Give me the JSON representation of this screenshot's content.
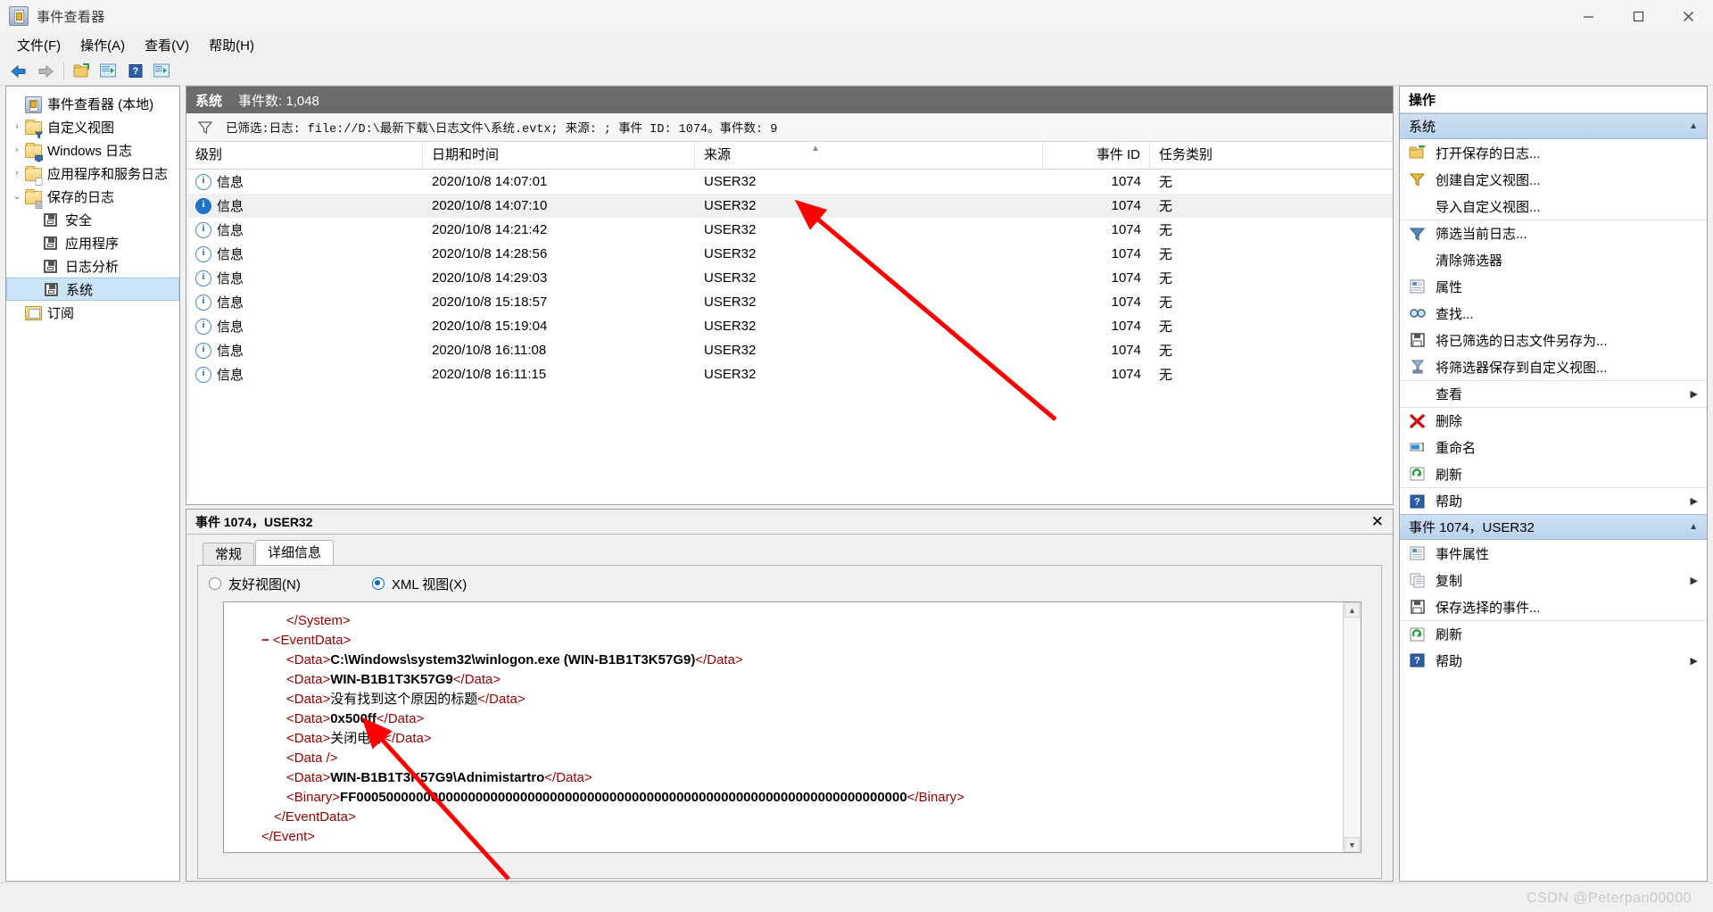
{
  "window": {
    "title": "事件查看器",
    "minimize": "—",
    "maximize": "□",
    "close": "✕"
  },
  "menu": {
    "items": [
      "文件(F)",
      "操作(A)",
      "查看(V)",
      "帮助(H)"
    ]
  },
  "toolbar": {
    "buttons": [
      "back-arrow",
      "forward-arrow",
      "open-saved-log",
      "new-custom-view",
      "help",
      "show-hide-action-pane"
    ]
  },
  "tree": {
    "root": {
      "label": "事件查看器 (本地)"
    },
    "items": [
      {
        "label": "自定义视图",
        "icon": "folder-filter-icon",
        "twist": "›",
        "indent": 1,
        "type": "folder"
      },
      {
        "label": "Windows 日志",
        "icon": "folder-computer-icon",
        "twist": "›",
        "indent": 1,
        "type": "folder"
      },
      {
        "label": "应用程序和服务日志",
        "icon": "folder-apps-icon",
        "twist": "›",
        "indent": 1,
        "type": "folder"
      },
      {
        "label": "保存的日志",
        "icon": "folder-saved-icon",
        "twist": "⌄",
        "indent": 1,
        "type": "folder"
      },
      {
        "label": "安全",
        "icon": "disk-icon",
        "twist": "",
        "indent": 2,
        "type": "log"
      },
      {
        "label": "应用程序",
        "icon": "disk-icon",
        "twist": "",
        "indent": 2,
        "type": "log"
      },
      {
        "label": "日志分析",
        "icon": "disk-icon",
        "twist": "",
        "indent": 2,
        "type": "log"
      },
      {
        "label": "系统",
        "icon": "disk-icon",
        "twist": "",
        "indent": 2,
        "type": "log",
        "selected": true
      },
      {
        "label": "订阅",
        "icon": "subscription-icon",
        "twist": "",
        "indent": 1,
        "type": "subscription"
      }
    ]
  },
  "log": {
    "name": "系统",
    "count_label": "事件数: 1,048",
    "filter_text": "已筛选:日志: file://D:\\最新下载\\日志文件\\系统.evtx; 来源: ; 事件 ID: 1074。事件数: 9"
  },
  "grid": {
    "columns": [
      "级别",
      "日期和时间",
      "来源",
      "事件 ID",
      "任务类别"
    ],
    "sorted_column_index": 1,
    "rows": [
      {
        "level": "信息",
        "datetime": "2020/10/8 14:07:01",
        "source": "USER32",
        "event_id": "1074",
        "task": "无",
        "selected": false
      },
      {
        "level": "信息",
        "datetime": "2020/10/8 14:07:10",
        "source": "USER32",
        "event_id": "1074",
        "task": "无",
        "selected": true
      },
      {
        "level": "信息",
        "datetime": "2020/10/8 14:21:42",
        "source": "USER32",
        "event_id": "1074",
        "task": "无",
        "selected": false
      },
      {
        "level": "信息",
        "datetime": "2020/10/8 14:28:56",
        "source": "USER32",
        "event_id": "1074",
        "task": "无",
        "selected": false
      },
      {
        "level": "信息",
        "datetime": "2020/10/8 14:29:03",
        "source": "USER32",
        "event_id": "1074",
        "task": "无",
        "selected": false
      },
      {
        "level": "信息",
        "datetime": "2020/10/8 15:18:57",
        "source": "USER32",
        "event_id": "1074",
        "task": "无",
        "selected": false
      },
      {
        "level": "信息",
        "datetime": "2020/10/8 15:19:04",
        "source": "USER32",
        "event_id": "1074",
        "task": "无",
        "selected": false
      },
      {
        "level": "信息",
        "datetime": "2020/10/8 16:11:08",
        "source": "USER32",
        "event_id": "1074",
        "task": "无",
        "selected": false
      },
      {
        "level": "信息",
        "datetime": "2020/10/8 16:11:15",
        "source": "USER32",
        "event_id": "1074",
        "task": "无",
        "selected": false
      }
    ]
  },
  "detail": {
    "header": "事件 1074，USER32",
    "close": "✕",
    "tabs": [
      {
        "label": "常规",
        "active": false
      },
      {
        "label": "详细信息",
        "active": true
      }
    ],
    "view_modes": [
      {
        "label": "友好视图(N)",
        "selected": false
      },
      {
        "label": "XML 视图(X)",
        "selected": true
      }
    ],
    "xml_lines": [
      {
        "indent": 3,
        "minus": false,
        "parts": [
          {
            "t": "tag",
            "v": "</System>"
          }
        ]
      },
      {
        "indent": 1,
        "minus": true,
        "parts": [
          {
            "t": "tag",
            "v": "<EventData>"
          }
        ]
      },
      {
        "indent": 3,
        "minus": false,
        "parts": [
          {
            "t": "tag",
            "v": "<Data>"
          },
          {
            "t": "bold",
            "v": "C:\\Windows\\system32\\winlogon.exe (WIN-B1B1T3K57G9)"
          },
          {
            "t": "tag",
            "v": "</Data>"
          }
        ]
      },
      {
        "indent": 3,
        "minus": false,
        "parts": [
          {
            "t": "tag",
            "v": "<Data>"
          },
          {
            "t": "bold",
            "v": "WIN-B1B1T3K57G9"
          },
          {
            "t": "tag",
            "v": "</Data>"
          }
        ]
      },
      {
        "indent": 3,
        "minus": false,
        "parts": [
          {
            "t": "tag",
            "v": "<Data>"
          },
          {
            "t": "plain",
            "v": "没有找到这个原因的标题"
          },
          {
            "t": "tag",
            "v": "</Data>"
          }
        ]
      },
      {
        "indent": 3,
        "minus": false,
        "parts": [
          {
            "t": "tag",
            "v": "<Data>"
          },
          {
            "t": "bold",
            "v": "0x500ff"
          },
          {
            "t": "tag",
            "v": "</Data>"
          }
        ]
      },
      {
        "indent": 3,
        "minus": false,
        "parts": [
          {
            "t": "tag",
            "v": "<Data>"
          },
          {
            "t": "plain",
            "v": "关闭电源"
          },
          {
            "t": "tag",
            "v": "</Data>"
          }
        ]
      },
      {
        "indent": 3,
        "minus": false,
        "parts": [
          {
            "t": "tag",
            "v": "<Data />"
          }
        ]
      },
      {
        "indent": 3,
        "minus": false,
        "parts": [
          {
            "t": "tag",
            "v": "<Data>"
          },
          {
            "t": "bold",
            "v": "WIN-B1B1T3K57G9\\Adnimistartro"
          },
          {
            "t": "tag",
            "v": "</Data>"
          }
        ]
      },
      {
        "indent": 3,
        "minus": false,
        "parts": [
          {
            "t": "tag",
            "v": "<Binary>"
          },
          {
            "t": "bold",
            "v": "FF00050000000000000000000000000000000000000000000000000000000000000000000000"
          },
          {
            "t": "tag",
            "v": "</Binary>"
          }
        ]
      },
      {
        "indent": 2,
        "minus": false,
        "parts": [
          {
            "t": "tag",
            "v": "</EventData>"
          }
        ]
      },
      {
        "indent": 1,
        "minus": false,
        "parts": [
          {
            "t": "tag",
            "v": "</Event>"
          }
        ]
      }
    ]
  },
  "actions": {
    "title": "操作",
    "groups": [
      {
        "name": "系统",
        "collapse": "▲",
        "items": [
          {
            "label": "打开保存的日志...",
            "icon": "open-saved-log-icon",
            "submenu": false,
            "separator_above": false
          },
          {
            "label": "创建自定义视图...",
            "icon": "create-custom-view-icon",
            "submenu": false,
            "separator_above": false
          },
          {
            "label": "导入自定义视图...",
            "icon": "",
            "submenu": false,
            "separator_above": false
          },
          {
            "label": "筛选当前日志...",
            "icon": "filter-current-log-icon",
            "submenu": false,
            "separator_above": true
          },
          {
            "label": "清除筛选器",
            "icon": "",
            "submenu": false,
            "separator_above": false
          },
          {
            "label": "属性",
            "icon": "properties-icon",
            "submenu": false,
            "separator_above": false
          },
          {
            "label": "查找...",
            "icon": "find-icon",
            "submenu": false,
            "separator_above": false
          },
          {
            "label": "将已筛选的日志文件另存为...",
            "icon": "save-filtered-log-icon",
            "submenu": false,
            "separator_above": false
          },
          {
            "label": "将筛选器保存到自定义视图...",
            "icon": "save-filter-to-custom-view-icon",
            "submenu": false,
            "separator_above": false
          },
          {
            "label": "查看",
            "icon": "",
            "submenu": true,
            "separator_above": true
          },
          {
            "label": "删除",
            "icon": "delete-icon",
            "submenu": false,
            "separator_above": true
          },
          {
            "label": "重命名",
            "icon": "rename-icon",
            "submenu": false,
            "separator_above": false
          },
          {
            "label": "刷新",
            "icon": "refresh-icon",
            "submenu": false,
            "separator_above": false
          },
          {
            "label": "帮助",
            "icon": "help-icon",
            "submenu": true,
            "separator_above": true
          }
        ]
      },
      {
        "name": "事件 1074，USER32",
        "collapse": "▲",
        "items": [
          {
            "label": "事件属性",
            "icon": "properties-icon",
            "submenu": false,
            "separator_above": false
          },
          {
            "label": "复制",
            "icon": "copy-icon",
            "submenu": true,
            "separator_above": false
          },
          {
            "label": "保存选择的事件...",
            "icon": "save-icon",
            "submenu": false,
            "separator_above": false
          },
          {
            "label": "刷新",
            "icon": "refresh-icon",
            "submenu": false,
            "separator_above": true
          },
          {
            "label": "帮助",
            "icon": "help-icon",
            "submenu": true,
            "separator_above": false
          }
        ]
      }
    ]
  },
  "watermark": "CSDN @Peterpan00000",
  "colors": {
    "title_bar_bg": "#6b6b6b",
    "group_header": "#b9d3ec",
    "selection": "#cce4f7",
    "xml_tag": "#990000",
    "annotation_arrow": "#ff0000"
  }
}
